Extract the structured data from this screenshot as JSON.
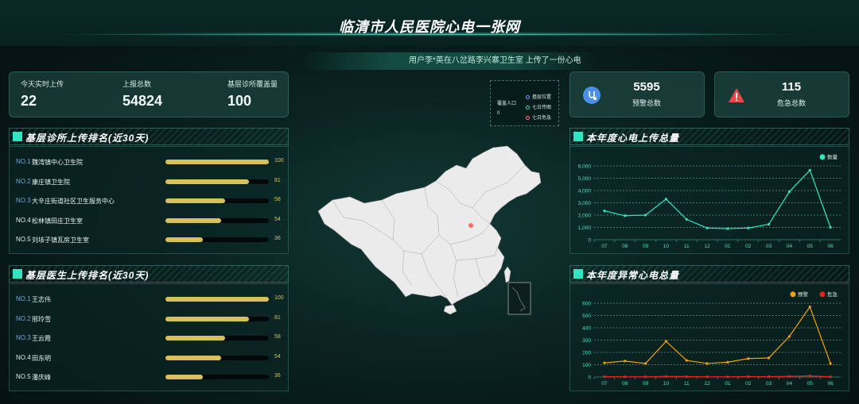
{
  "header": {
    "title": "临清市人民医院心电一张网"
  },
  "marquee": {
    "text": "用户李*英在八岔路李兴寨卫生室 上传了一份心电"
  },
  "stats": {
    "today_label": "今天实时上传",
    "today_value": "22",
    "total_label": "上报总数",
    "total_value": "54824",
    "coverage_label": "基层诊所覆盖量",
    "coverage_value": "100"
  },
  "alerts": {
    "warning_value": "5595",
    "warning_label": "预警总数",
    "danger_value": "115",
    "danger_label": "危急总数"
  },
  "map_legend": {
    "title": "覆盖人口",
    "value": "0",
    "items": [
      {
        "label": "基层位置",
        "color": "#7aa2f7"
      },
      {
        "label": "七日传图",
        "color": "#4fd1a5"
      },
      {
        "label": "七日危急",
        "color": "#ff7a90"
      }
    ]
  },
  "clinic_ranking": {
    "title": "基层诊所上传排名(近30天)",
    "items": [
      {
        "no": "NO.1",
        "name": "魏湾镇中心卫生院",
        "value": 100,
        "value_text": "100"
      },
      {
        "no": "NO.2",
        "name": "康庄镇卫生院",
        "value": 81,
        "value_text": "81"
      },
      {
        "no": "NO.3",
        "name": "大辛庄街道社区卫生服务中心",
        "value": 58,
        "value_text": "58"
      },
      {
        "no": "NO.4",
        "name": "松林镇田庄卫生室",
        "value": 54,
        "value_text": "54"
      },
      {
        "no": "NO.5",
        "name": "刘垓子镇瓦房卫生室",
        "value": 36,
        "value_text": "36"
      }
    ]
  },
  "doctor_ranking": {
    "title": "基层医生上传排名(近30天)",
    "items": [
      {
        "no": "NO.1",
        "name": "王志伟",
        "value": 100,
        "value_text": "100"
      },
      {
        "no": "NO.2",
        "name": "邢玲雪",
        "value": 81,
        "value_text": "81"
      },
      {
        "no": "NO.3",
        "name": "王云霞",
        "value": 58,
        "value_text": "58"
      },
      {
        "no": "NO.4",
        "name": "田东明",
        "value": 54,
        "value_text": "54"
      },
      {
        "no": "NO.5",
        "name": "潘庆峰",
        "value": 36,
        "value_text": "36"
      }
    ]
  },
  "chart_data": [
    {
      "type": "line",
      "title": "本年度心电上传总量",
      "categories": [
        "07",
        "08",
        "09",
        "10",
        "11",
        "12",
        "01",
        "02",
        "03",
        "04",
        "05",
        "06"
      ],
      "ylim": [
        0,
        6000
      ],
      "yticks": [
        "0",
        "1,000",
        "2,000",
        "3,000",
        "4,000",
        "5,000",
        "6,000"
      ],
      "grid": true,
      "legend_position": "top-right",
      "series": [
        {
          "name": "数量",
          "color": "#2fe6c0",
          "values": [
            2350,
            1950,
            2000,
            3300,
            1650,
            950,
            900,
            950,
            1250,
            3900,
            5650,
            1000
          ]
        }
      ]
    },
    {
      "type": "line",
      "title": "本年度异常心电总量",
      "categories": [
        "07",
        "08",
        "09",
        "10",
        "11",
        "12",
        "01",
        "02",
        "03",
        "04",
        "05",
        "06"
      ],
      "ylim": [
        0,
        600
      ],
      "yticks": [
        "0",
        "100",
        "200",
        "300",
        "400",
        "500",
        "600"
      ],
      "grid": true,
      "legend_position": "top-right",
      "series": [
        {
          "name": "预警",
          "color": "#f0a20c",
          "values": [
            115,
            130,
            110,
            290,
            135,
            110,
            120,
            150,
            155,
            330,
            570,
            110
          ]
        },
        {
          "name": "危急",
          "color": "#e8231f",
          "values": [
            3,
            2,
            2,
            5,
            3,
            2,
            2,
            3,
            3,
            5,
            9,
            2
          ]
        }
      ]
    }
  ]
}
